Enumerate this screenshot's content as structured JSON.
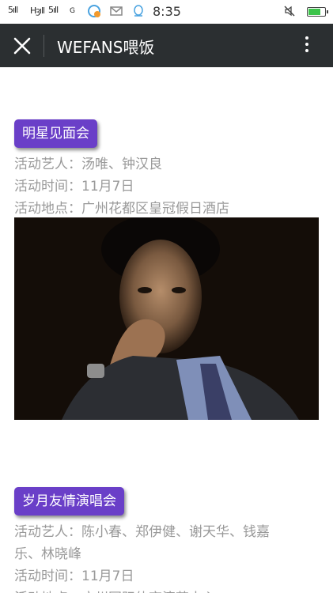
{
  "status_bar": {
    "signal_1": "5ıll",
    "signal_2": "Hꝫıll",
    "signal_3": "5ıll",
    "net": "G",
    "time": "8:35",
    "colors": {
      "battery": "#3cc34a"
    }
  },
  "title_bar": {
    "title": "WEFANS喂饭",
    "close_icon": "close-icon",
    "more_icon": "more-vertical-icon",
    "colors": {
      "background": "#2b2f31"
    }
  },
  "events": [
    {
      "tag": "明星见面会",
      "artists": "活动艺人：汤唯、钟汉良",
      "time": "活动时间：11月7日",
      "location": "活动地点：广州花都区皇冠假日酒店"
    },
    {
      "tag": "岁月友情演唱会",
      "artists_line1": "活动艺人：陈小春、郑伊健、谢天华、钱嘉",
      "artists_line2": "乐、林晓峰",
      "time": "活动时间：11月7日",
      "location_partial": "活动地点：广州国际体育演艺中心"
    }
  ],
  "colors": {
    "tag": "#6a3fc8",
    "text": "#999999"
  }
}
